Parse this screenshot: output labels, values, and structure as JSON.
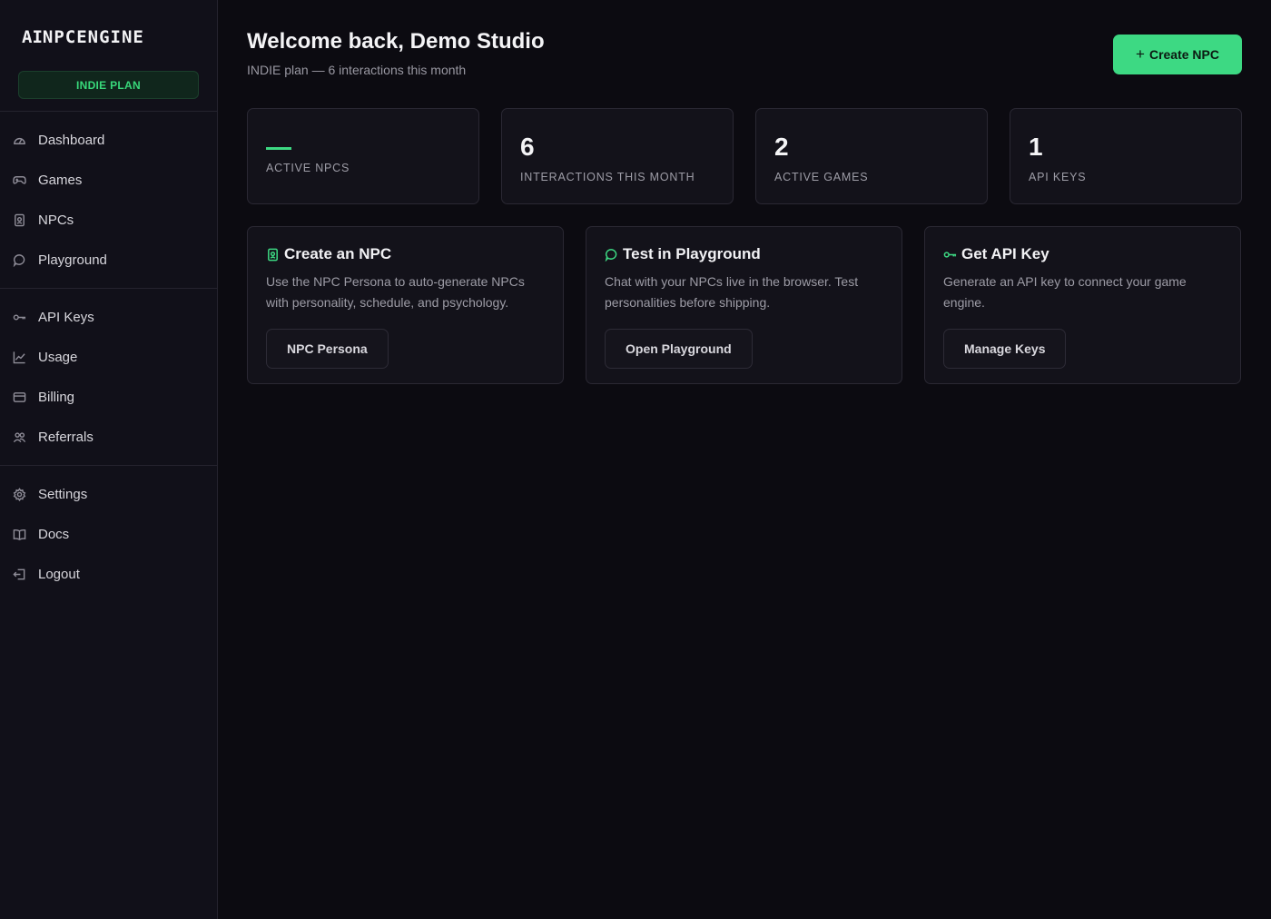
{
  "sidebar": {
    "logo": {
      "ai": "AI",
      "rest": "NPCENGINE"
    },
    "plan_badge": "INDIE PLAN",
    "groups": [
      [
        {
          "label": "Dashboard",
          "icon": "gauge-icon"
        },
        {
          "label": "Games",
          "icon": "gamepad-icon"
        },
        {
          "label": "NPCs",
          "icon": "id-badge-icon"
        },
        {
          "label": "Playground",
          "icon": "chat-bubble-icon"
        }
      ],
      [
        {
          "label": "API Keys",
          "icon": "key-icon"
        },
        {
          "label": "Usage",
          "icon": "line-chart-icon"
        },
        {
          "label": "Billing",
          "icon": "credit-card-icon"
        },
        {
          "label": "Referrals",
          "icon": "users-icon"
        }
      ],
      [
        {
          "label": "Settings",
          "icon": "gear-icon"
        },
        {
          "label": "Docs",
          "icon": "book-icon"
        },
        {
          "label": "Logout",
          "icon": "logout-icon"
        }
      ]
    ]
  },
  "header": {
    "title": "Welcome back, Demo Studio",
    "subtitle": "INDIE plan — 6 interactions this month",
    "create_button": "Create NPC"
  },
  "stats": [
    {
      "value": "",
      "label": "ACTIVE NPCS",
      "loading": true
    },
    {
      "value": "6",
      "label": "INTERACTIONS THIS MONTH"
    },
    {
      "value": "2",
      "label": "ACTIVE GAMES"
    },
    {
      "value": "1",
      "label": "API KEYS"
    }
  ],
  "cards": [
    {
      "title": "Create an NPC",
      "icon": "id-badge-icon",
      "description": "Use the NPC Persona to auto-generate NPCs with personality, schedule, and psychology.",
      "button": "NPC Persona"
    },
    {
      "title": "Test in Playground",
      "icon": "chat-bubble-icon",
      "description": "Chat with your NPCs live in the browser. Test personalities before shipping.",
      "button": "Open Playground"
    },
    {
      "title": "Get API Key",
      "icon": "key-icon",
      "description": "Generate an API key to connect your game engine.",
      "button": "Manage Keys"
    }
  ],
  "colors": {
    "accent": "#3dd983",
    "background": "#0c0b11",
    "sidebar": "#111019",
    "card": "#13121a"
  }
}
